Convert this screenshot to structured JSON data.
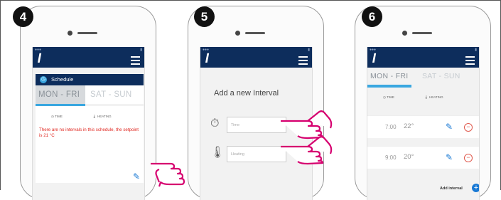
{
  "steps": [
    "4",
    "5",
    "6"
  ],
  "screen4": {
    "schedule_title": "Schedule",
    "tab_active": "MON - FRI",
    "tab_inactive": "SAT - SUN",
    "col_time": "TIME",
    "col_heating": "HEATING",
    "message": "There are no intervals in this schedule, the setpoint is 21 °C"
  },
  "screen5": {
    "title": "Add a new Interval",
    "time_placeholder": "Time",
    "heating_placeholder": "Heating"
  },
  "screen6": {
    "tab_active": "MON - FRI",
    "tab_inactive": "SAT - SUN",
    "col_time": "TIME",
    "col_heating": "HEATING",
    "intervals": [
      {
        "time": "7:00",
        "temp": "22°"
      },
      {
        "time": "9:00",
        "temp": "20°"
      }
    ],
    "add_interval": "Add interval"
  },
  "icons": {
    "logo": "logo-s-icon",
    "menu": "hamburger-menu-icon",
    "edit": "pencil-icon",
    "remove": "minus-circle-icon",
    "add": "plus-circle-icon",
    "pointer": "pointing-hand-icon"
  },
  "colors": {
    "navbar": "#0d2d5c",
    "accent": "#3aa7e0",
    "error": "#e0261f",
    "step_badge": "#111111",
    "hand": "#d6006f"
  }
}
